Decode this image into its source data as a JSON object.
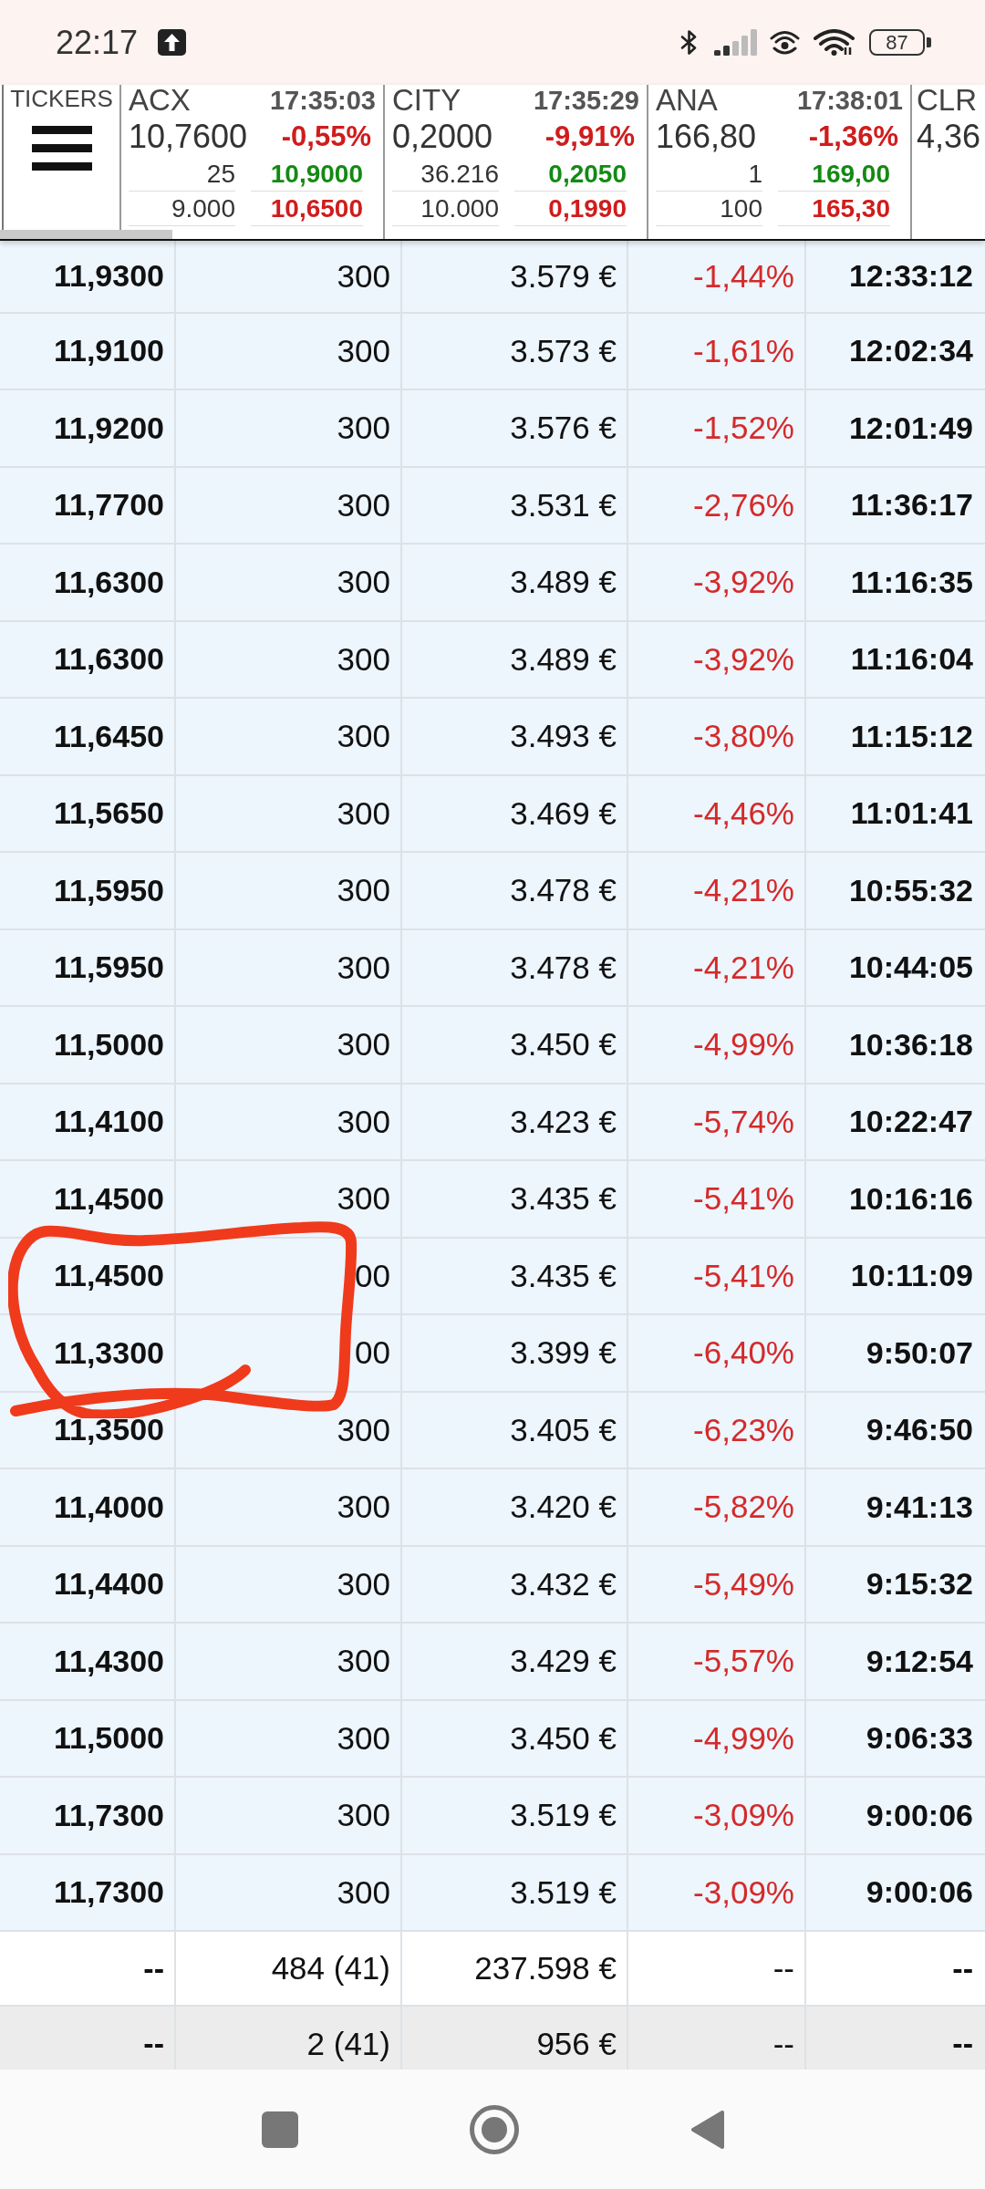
{
  "status_bar": {
    "time": "22:17",
    "battery": "87"
  },
  "ticker_strip": {
    "label": "TICKERS",
    "tickers": [
      {
        "symbol": "ACX",
        "time": "17:35:03",
        "last": "10,7600",
        "change": "-0,55%",
        "negative": true,
        "quote_rows": [
          {
            "size": "25",
            "price": "10,9000"
          },
          {
            "size": "9.000",
            "price": "10,6500"
          }
        ]
      },
      {
        "symbol": "CITY",
        "time": "17:35:29",
        "last": "0,2000",
        "change": "-9,91%",
        "negative": true,
        "quote_rows": [
          {
            "size": "36.216",
            "price": "0,2050"
          },
          {
            "size": "10.000",
            "price": "0,1990"
          }
        ]
      },
      {
        "symbol": "ANA",
        "time": "17:38:01",
        "last": "166,80",
        "change": "-1,36%",
        "negative": true,
        "quote_rows": [
          {
            "size": "1",
            "price": "169,00"
          },
          {
            "size": "100",
            "price": "165,30"
          }
        ]
      },
      {
        "symbol": "CLR",
        "last": "4,36"
      }
    ]
  },
  "trades": {
    "rows": [
      {
        "cells": [
          "11,9300",
          "300",
          "3.579 €",
          "-1,44%",
          "12:33:12"
        ],
        "negative": true
      },
      {
        "cells": [
          "11,9100",
          "300",
          "3.573 €",
          "-1,61%",
          "12:02:34"
        ],
        "negative": true
      },
      {
        "cells": [
          "11,9200",
          "300",
          "3.576 €",
          "-1,52%",
          "12:01:49"
        ],
        "negative": true
      },
      {
        "cells": [
          "11,7700",
          "300",
          "3.531 €",
          "-2,76%",
          "11:36:17"
        ],
        "negative": true
      },
      {
        "cells": [
          "11,6300",
          "300",
          "3.489 €",
          "-3,92%",
          "11:16:35"
        ],
        "negative": true
      },
      {
        "cells": [
          "11,6300",
          "300",
          "3.489 €",
          "-3,92%",
          "11:16:04"
        ],
        "negative": true
      },
      {
        "cells": [
          "11,6450",
          "300",
          "3.493 €",
          "-3,80%",
          "11:15:12"
        ],
        "negative": true
      },
      {
        "cells": [
          "11,5650",
          "300",
          "3.469 €",
          "-4,46%",
          "11:01:41"
        ],
        "negative": true
      },
      {
        "cells": [
          "11,5950",
          "300",
          "3.478 €",
          "-4,21%",
          "10:55:32"
        ],
        "negative": true
      },
      {
        "cells": [
          "11,5950",
          "300",
          "3.478 €",
          "-4,21%",
          "10:44:05"
        ],
        "negative": true
      },
      {
        "cells": [
          "11,5000",
          "300",
          "3.450 €",
          "-4,99%",
          "10:36:18"
        ],
        "negative": true
      },
      {
        "cells": [
          "11,4100",
          "300",
          "3.423 €",
          "-5,74%",
          "10:22:47"
        ],
        "negative": true
      },
      {
        "cells": [
          "11,4500",
          "300",
          "3.435 €",
          "-5,41%",
          "10:16:16"
        ],
        "negative": true
      },
      {
        "cells": [
          "11,4500",
          "00",
          "3.435 €",
          "-5,41%",
          "10:11:09"
        ],
        "negative": true
      },
      {
        "cells": [
          "11,3300",
          "00",
          "3.399 €",
          "-6,40%",
          "9:50:07"
        ],
        "negative": true
      },
      {
        "cells": [
          "11,3500",
          "300",
          "3.405 €",
          "-6,23%",
          "9:46:50"
        ],
        "negative": true
      },
      {
        "cells": [
          "11,4000",
          "300",
          "3.420 €",
          "-5,82%",
          "9:41:13"
        ],
        "negative": true
      },
      {
        "cells": [
          "11,4400",
          "300",
          "3.432 €",
          "-5,49%",
          "9:15:32"
        ],
        "negative": true
      },
      {
        "cells": [
          "11,4300",
          "300",
          "3.429 €",
          "-5,57%",
          "9:12:54"
        ],
        "negative": true
      },
      {
        "cells": [
          "11,5000",
          "300",
          "3.450 €",
          "-4,99%",
          "9:06:33"
        ],
        "negative": true
      },
      {
        "cells": [
          "11,7300",
          "300",
          "3.519 €",
          "-3,09%",
          "9:00:06"
        ],
        "negative": true
      },
      {
        "cells": [
          "11,7300",
          "300",
          "3.519 €",
          "-3,09%",
          "9:00:06"
        ],
        "negative": true
      }
    ],
    "summary_rows": [
      {
        "cells": [
          "--",
          "484 (41)",
          "237.598 €",
          "--",
          "--"
        ],
        "shaded": false
      },
      {
        "cells": [
          "--",
          "2 (41)",
          "956 €",
          "--",
          "--"
        ],
        "shaded": true
      }
    ]
  },
  "annotation": {
    "kind": "freehand_loop"
  }
}
